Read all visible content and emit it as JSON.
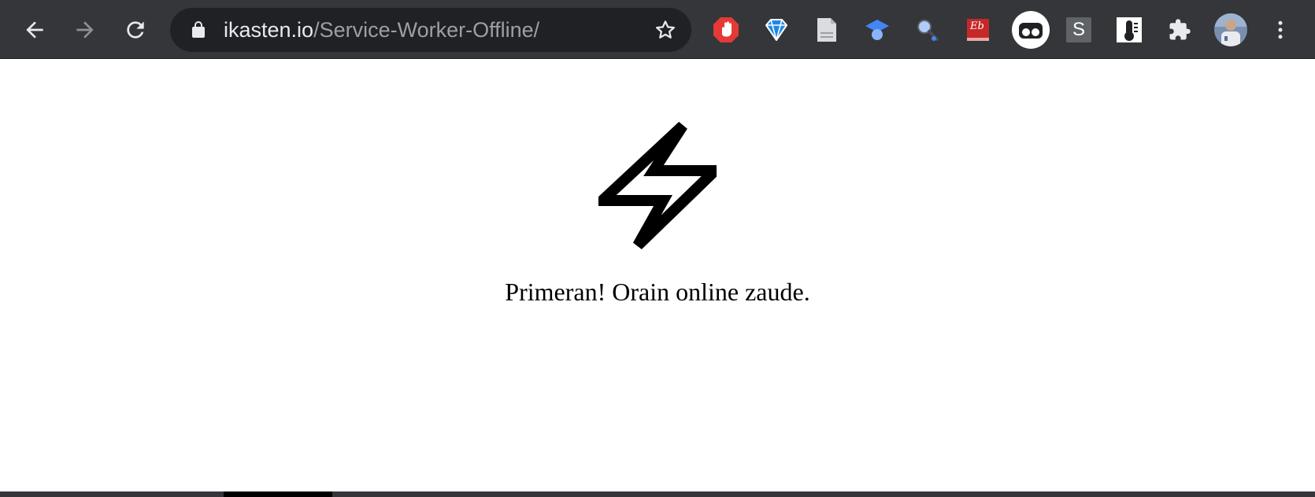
{
  "browser": {
    "url_host": "ikasten.io",
    "url_path": "/Service-Worker-Offline/",
    "nav": {
      "back_icon": "back-arrow-icon",
      "forward_icon": "forward-arrow-icon",
      "reload_icon": "reload-icon"
    },
    "bookmark_icon": "star-icon",
    "extensions": [
      {
        "name": "adblock-icon"
      },
      {
        "name": "diamond-icon"
      },
      {
        "name": "document-icon"
      },
      {
        "name": "graduation-cap-icon"
      },
      {
        "name": "magnifier-icon"
      },
      {
        "name": "eb-icon",
        "label": "Eb"
      },
      {
        "name": "toggle-icon"
      },
      {
        "name": "s-icon",
        "label": "S"
      },
      {
        "name": "thermometer-icon"
      },
      {
        "name": "puzzle-icon"
      },
      {
        "name": "profile-avatar"
      },
      {
        "name": "kebab-menu-icon"
      }
    ]
  },
  "page": {
    "icon": "lightning-bolt-icon",
    "message": "Primeran! Orain online zaude."
  }
}
